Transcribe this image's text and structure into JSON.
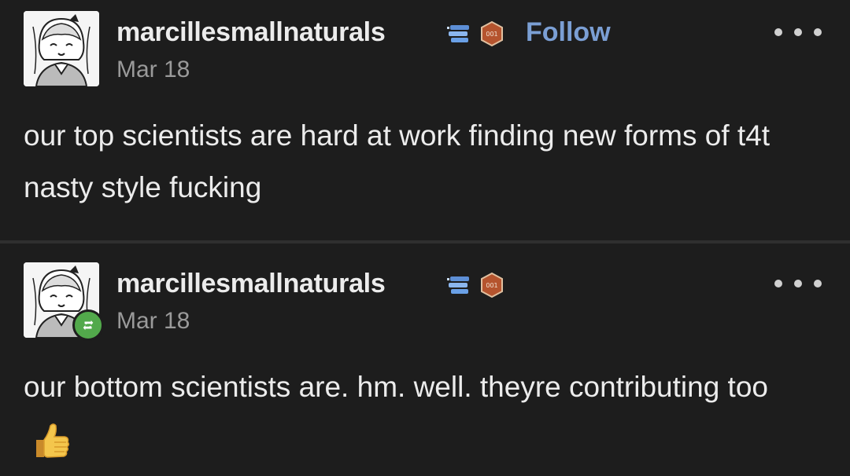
{
  "posts": [
    {
      "username": "marcillesmallnaturals",
      "date": "Mar 18",
      "follow_label": "Follow",
      "text": "our top scientists are hard at work finding new forms of t4t nasty style fucking",
      "avatar_icon": "anime-girl-avatar",
      "badges": [
        "books-badge-icon",
        "hex-badge-icon"
      ]
    },
    {
      "username": "marcillesmallnaturals",
      "date": "Mar 18",
      "text": "our bottom scientists are. hm. well. theyre contributing too",
      "emoji": "thumbs-up-emoji",
      "avatar_icon": "anime-girl-avatar",
      "reblog_icon": "reblog-icon",
      "badges": [
        "books-badge-icon",
        "hex-badge-icon"
      ]
    }
  ],
  "colors": {
    "background": "#1d1d1d",
    "follow": "#7b9fd4",
    "date": "#9a9a9a",
    "reblog_badge": "#52a94b"
  }
}
